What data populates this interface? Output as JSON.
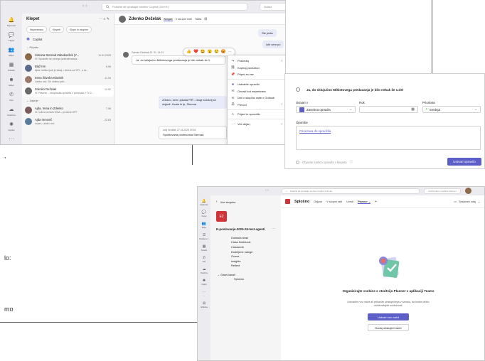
{
  "background": {
    "fragments": [
      ",",
      "lo:",
      "mo"
    ]
  },
  "chat_window": {
    "search_placeholder": "Poiščite ali vprašajte storitev Copilot (Ctrl+E)",
    "corner_button": "Dokaz",
    "rail": [
      {
        "label": "Dejavnost",
        "icon": "bell-icon"
      },
      {
        "label": "Klepet",
        "icon": "chat-icon"
      },
      {
        "label": "Ekipe",
        "icon": "teams-icon"
      },
      {
        "label": "Koledar",
        "icon": "calendar-icon"
      },
      {
        "label": "Ekipe",
        "icon": "people-icon"
      },
      {
        "label": "Klici",
        "icon": "phone-icon"
      },
      {
        "label": "OneDrive",
        "icon": "cloud-icon"
      },
      {
        "label": "Copilot",
        "icon": "copilot-icon"
      },
      {
        "label": "...",
        "icon": "more-icon"
      }
    ],
    "list_title": "Klepet",
    "filters": [
      "Neprebrano",
      "Klepeti",
      "Ekipe in skupine"
    ],
    "copilot_label": "Copilot",
    "pinned_header": "Pripeto",
    "pinned": [
      {
        "name": "Simona Sternad Zabukovšek (Y...",
        "preview": "Vi: Spoznite se prvega izobraževanja...",
        "time": "11.01.2025",
        "color": "#8a6a4a"
      },
      {
        "name": "Blaž Irm",
        "preview": "Ajda: koliko ljudi je tukaj v Arena za SPI - a ta...",
        "time": "8.96",
        "color": "#5a6a8a"
      },
      {
        "name": "Irena Štivoha Klavinik",
        "preview": "Lahko noč. Se vidimo jutri...",
        "time": "11.94",
        "color": "#9a7a6a"
      },
      {
        "name": "Zdenko Deželak",
        "preview": "Vi: Planner – skupinska opravila v povezavi z Tr D...",
        "time": "12:52",
        "color": "#6a6a6a"
      }
    ],
    "recent_header": "Zadnje",
    "recent": [
      {
        "name": "Ajda, Irena in Zdenko",
        "preview": "Vi: kvik ta uvršen EDA – prodirat OFF",
        "time": "7.96",
        "color": "#7a5a5a"
      },
      {
        "name": "Ajda Irenovič",
        "preview": "super, Lahko noč",
        "time": "22.63",
        "color": "#5a7a9a"
      }
    ],
    "chat_header": {
      "name": "Zdenko Deželak",
      "tabs": [
        "Klepet",
        "V skupni rabi",
        "Tabla"
      ]
    },
    "messages": [
      {
        "text": "Ste jedla",
        "kind": "out"
      },
      {
        "text": "lubi sem po",
        "kind": "out"
      },
      {
        "meta": "Zdenko Deželak 22. 01. 14:21",
        "text": "Ja, do sklujučno Miklotovega predavanja je bilo nekak že 1.",
        "kind": "in"
      },
      {
        "text": "Zdravo, sem upisala PIR - drugi kolokvij se objavil. Hvala in lp, Simona",
        "kind": "out"
      },
      {
        "meta": "Izbij Verdibil: 27.01.2025 20:54",
        "text": "Spoštovana profesorica Sternad,",
        "kind": "out"
      }
    ],
    "reactions": [
      "👍",
      "❤️",
      "😆",
      "😮",
      "😢",
      "😡"
    ],
    "reaction_more": "⋯",
    "context_menu": [
      {
        "label": "Posreduj",
        "icon": "forward-icon",
        "chevron": true
      },
      {
        "label": "Kopiraj povezavo",
        "icon": "link-icon"
      },
      {
        "label": "Pripni za vse",
        "icon": "pin-icon"
      },
      {
        "sep": true
      },
      {
        "label": "Ustvarite opravilo",
        "icon": "planner-icon",
        "highlight": true
      },
      {
        "label": "Označi kot neprebrano",
        "icon": "unread-icon"
      },
      {
        "label": "Deli v skupino rabe v Outlook",
        "icon": "outlook-icon"
      },
      {
        "label": "Prevod",
        "icon": "translate-icon",
        "chevron": true
      },
      {
        "sep": true
      },
      {
        "label": "Prijavi to sporočilo",
        "icon": "report-icon"
      },
      {
        "sep": true
      },
      {
        "label": "Več dejanj",
        "icon": "more-actions-icon",
        "chevron": true
      }
    ]
  },
  "task_dialog": {
    "title": "Ja, do sklujučno Miklotovega predavanja je bilo nekak že 1.del",
    "bucket_label": "Ustvari v",
    "bucket_value": "Zasebna opravila",
    "due_label": "Rok",
    "priority_label": "Prioriteta",
    "priority_value": "Srednja",
    "notes_label": "Opombe",
    "notes_link": "Povezava do sporočila",
    "footer_check": "Objavite kartico opravila v klepetu",
    "create_button": "Ustvari opravilo"
  },
  "team_window": {
    "search_placeholder": "Poiščite ali vprašajte storitev Copilot (Ctrl+E)",
    "corner_button": "Vzdrževalno središče Planner",
    "back_label": "Vse skupine",
    "team_initials": "E2",
    "team_name": "E-poslovanje-2025-26-test-agenti",
    "team_more": "⋯",
    "channels": [
      "Domača stran",
      "Class Notebook",
      "Classwork",
      "Dodeljene naloge",
      "Ocene",
      "Insights",
      "Reflect"
    ],
    "hidden_header": "Glavni kanali",
    "hidden_items": [
      "Splošno"
    ],
    "rail": [
      {
        "label": "Dejavnost",
        "icon": "bell-icon"
      },
      {
        "label": "Klepet",
        "icon": "chat-icon"
      },
      {
        "label": "Ekipe",
        "icon": "teams-icon"
      },
      {
        "label": "Dodeljene n.",
        "icon": "assign-icon"
      },
      {
        "label": "Koledar",
        "icon": "calendar-icon"
      },
      {
        "label": "Klici",
        "icon": "phone-icon"
      },
      {
        "label": "OneDrive",
        "icon": "cloud-icon"
      },
      {
        "label": "Copilot",
        "icon": "copilot-icon"
      },
      {
        "label": "...",
        "icon": "more-icon"
      },
      {
        "label": "Aplikacije",
        "icon": "apps-icon"
      }
    ],
    "channel_title": "Splošno",
    "tabs": [
      "Objave",
      "V skupni rabi",
      "Uvrsti",
      "Planner"
    ],
    "meeting_label": "Sestanek zdaj",
    "empty_title": "Organizirajte vsebine s storitvijo Planner v aplikaciji Teams",
    "empty_body": "Ustvarite nov načrt ali prikazite obstoječega v kanalu, da boste lahko učinkovitejše sodelovali.",
    "new_plan_button": "Ustvari nov načrt",
    "add_plan_button": "Dodaj obstoječi načrt"
  }
}
